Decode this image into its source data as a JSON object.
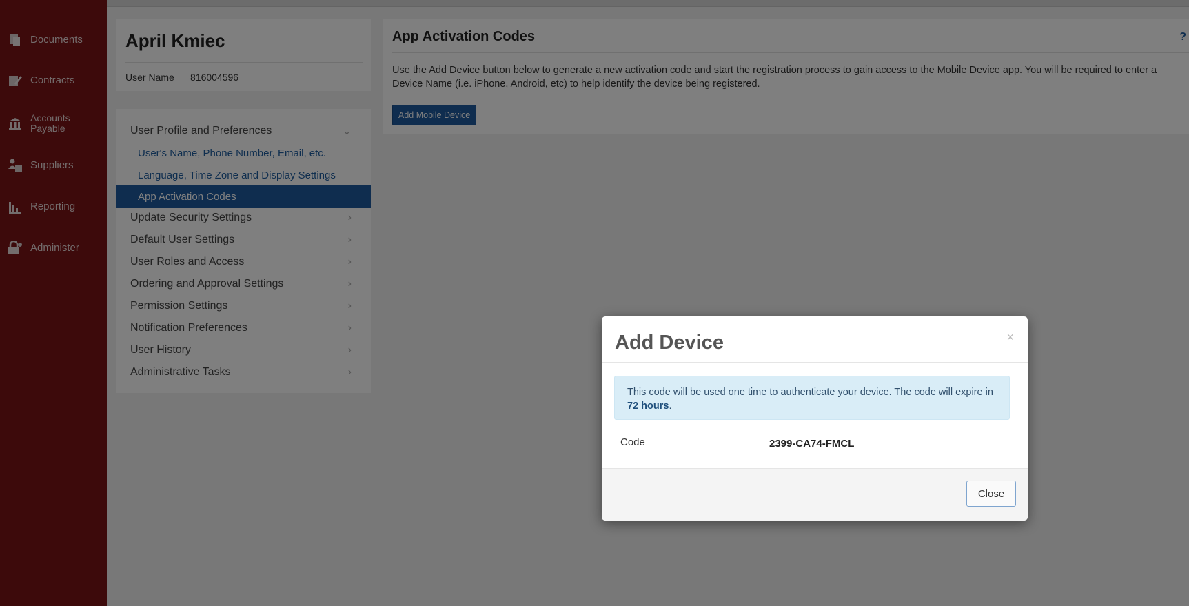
{
  "leftnav": {
    "items": [
      {
        "label": "Documents",
        "icon": "documents-icon"
      },
      {
        "label": "Contracts",
        "icon": "contracts-icon"
      },
      {
        "label": "Accounts Payable",
        "label_line1": "Accounts",
        "label_line2": "Payable",
        "icon": "bank-icon"
      },
      {
        "label": "Suppliers",
        "icon": "suppliers-icon"
      },
      {
        "label": "Reporting",
        "icon": "bar-chart-icon"
      },
      {
        "label": "Administer",
        "icon": "admin-lock-icon"
      }
    ]
  },
  "profile": {
    "name": "April Kmiec",
    "username_label": "User Name",
    "username_value": "816004596"
  },
  "menu": {
    "items": [
      {
        "label": "User Profile and Preferences",
        "type": "section",
        "chevron": "⌄"
      },
      {
        "label": "User's Name, Phone Number, Email, etc.",
        "type": "sub"
      },
      {
        "label": "Language, Time Zone and Display Settings",
        "type": "sub"
      },
      {
        "label": "App Activation Codes",
        "type": "sub",
        "active": true
      },
      {
        "label": "Update Security Settings",
        "type": "section",
        "chevron": "›"
      },
      {
        "label": "Default User Settings",
        "type": "section",
        "chevron": "›"
      },
      {
        "label": "User Roles and Access",
        "type": "section",
        "chevron": "›"
      },
      {
        "label": "Ordering and Approval Settings",
        "type": "section",
        "chevron": "›"
      },
      {
        "label": "Permission Settings",
        "type": "section",
        "chevron": "›"
      },
      {
        "label": "Notification Preferences",
        "type": "section",
        "chevron": "›"
      },
      {
        "label": "User History",
        "type": "section",
        "chevron": "›"
      },
      {
        "label": "Administrative Tasks",
        "type": "section",
        "chevron": "›"
      }
    ]
  },
  "main": {
    "title": "App Activation Codes",
    "help": "?",
    "description": "Use the Add Device button below to generate a new activation code and start the registration process to gain access to the Mobile Device app. You will be required to enter a Device Name (i.e. iPhone, Android, etc) to help identify the device being registered.",
    "add_button": "Add Mobile Device"
  },
  "modal": {
    "title": "Add Device",
    "close_x": "×",
    "info_text_1": "This code will be used one time to authenticate your device. The code will expire in ",
    "info_bold": "72 hours",
    "info_text_2": ".",
    "code_label": "Code",
    "code_value": "2399-CA74-FMCL",
    "close_button": "Close"
  },
  "colors": {
    "nav_bg": "#7b1517",
    "accent": "#1f5a9e",
    "alert_bg": "#d9edf7"
  }
}
